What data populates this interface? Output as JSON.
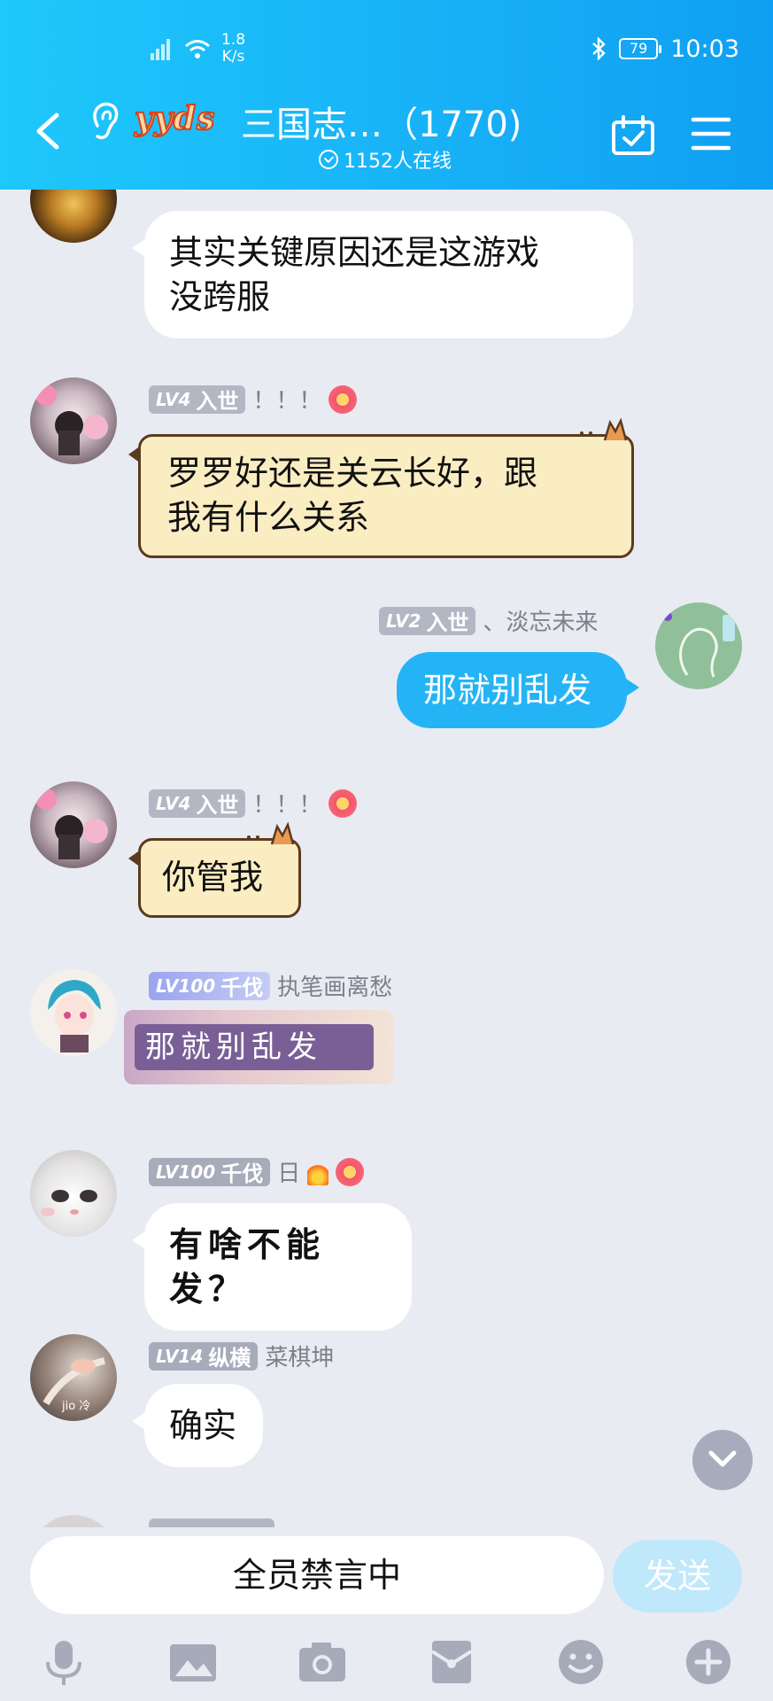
{
  "status_bar": {
    "speed": "1.8",
    "speed_unit": "K/s",
    "battery": "79",
    "time": "10:03"
  },
  "header": {
    "badge": "yyds",
    "title": "三国志…（1770)",
    "online": "1152人在线"
  },
  "messages": [
    {
      "id": "m1",
      "text_line1": "其实关键原因还是这游戏",
      "text_line2": "没跨服"
    },
    {
      "id": "m2",
      "level": "LV4",
      "rank": "入世",
      "name": "！！！",
      "text_line1": "罗罗好还是关云长好，跟",
      "text_line2": "我有什么关系"
    },
    {
      "id": "m3",
      "level": "LV2",
      "rank": "入世",
      "name": "、淡忘未来",
      "text": "那就别乱发"
    },
    {
      "id": "m4",
      "level": "LV4",
      "rank": "入世",
      "name": "！！！",
      "text": "你管我"
    },
    {
      "id": "m5",
      "level": "LV100",
      "rank": "千伐",
      "name": "执笔画离愁",
      "sticker_text": "那就别乱发"
    },
    {
      "id": "m6",
      "level": "LV100",
      "rank": "千伐",
      "name": "日",
      "text": "有啥不能发？"
    },
    {
      "id": "m7",
      "level": "LV14",
      "rank": "纵横",
      "name": "菜棋坤",
      "text": "确实",
      "avatar_text": "jio 冷"
    }
  ],
  "input": {
    "muted_text": "全员禁言中",
    "send_label": "发送"
  },
  "colors": {
    "header_start": "#1ec8fb",
    "header_end": "#0f9ff2",
    "my_bubble": "#24b4f5",
    "background": "#e9ebf3"
  },
  "icons": [
    "back-icon",
    "ear-icon",
    "calendar-check-icon",
    "menu-icon",
    "microphone-icon",
    "image-icon",
    "camera-icon",
    "red-packet-icon",
    "emoji-icon",
    "plus-icon",
    "chevron-down-icon"
  ]
}
